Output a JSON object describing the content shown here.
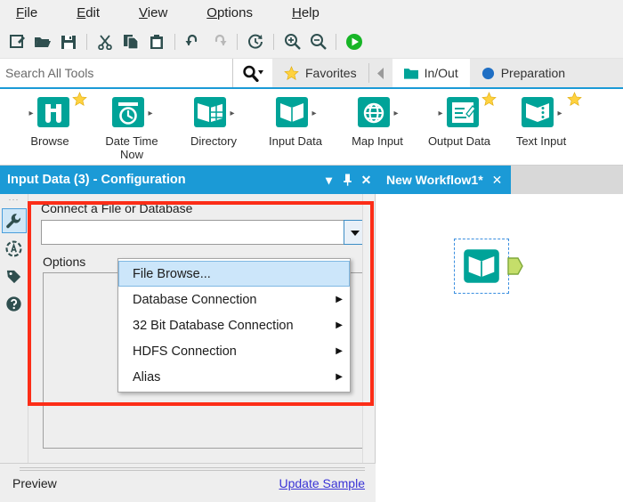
{
  "menu": {
    "items": [
      {
        "label": "File",
        "accel": "F"
      },
      {
        "label": "Edit",
        "accel": "E"
      },
      {
        "label": "View",
        "accel": "V"
      },
      {
        "label": "Options",
        "accel": "O"
      },
      {
        "label": "Help",
        "accel": "H"
      }
    ]
  },
  "toolbar": {
    "buttons": [
      {
        "name": "new-workflow-icon",
        "title": "New"
      },
      {
        "name": "open-folder-icon",
        "title": "Open"
      },
      {
        "name": "save-icon",
        "title": "Save"
      },
      {
        "name": "cut-scissors-icon",
        "title": "Cut"
      },
      {
        "name": "copy-icon",
        "title": "Copy"
      },
      {
        "name": "paste-clipboard-icon",
        "title": "Paste"
      },
      {
        "name": "undo-arrow-icon",
        "title": "Undo"
      },
      {
        "name": "redo-arrow-icon",
        "title": "Redo"
      },
      {
        "name": "refresh-clock-icon",
        "title": "Refresh"
      },
      {
        "name": "zoom-in-icon",
        "title": "Zoom In"
      },
      {
        "name": "zoom-out-icon",
        "title": "Zoom Out"
      },
      {
        "name": "run-play-icon",
        "title": "Run Workflow"
      }
    ]
  },
  "search": {
    "placeholder": "Search All Tools",
    "value": "",
    "button_icon": "search-magnifier-dropdown-icon"
  },
  "categories": {
    "scroll_left_icon": "chevron-left-icon",
    "tabs": [
      {
        "label": "Favorites",
        "icon": "star-icon",
        "active": false
      },
      {
        "label": "In/Out",
        "icon": "folder-icon",
        "active": true
      },
      {
        "label": "Preparation",
        "icon": "circle-icon",
        "active": false
      }
    ]
  },
  "ribbon": {
    "tools": [
      {
        "label": "Browse",
        "icon": "binoculars-icon",
        "favorite": true,
        "chevron": "left"
      },
      {
        "label": "Date Time\nNow",
        "icon": "clock-icon",
        "favorite": false,
        "chevron": "right"
      },
      {
        "label": "Directory",
        "icon": "book-grid-icon",
        "favorite": false,
        "chevron": "right"
      },
      {
        "label": "Input Data",
        "icon": "open-book-icon",
        "favorite": false,
        "chevron": "right"
      },
      {
        "label": "Map Input",
        "icon": "globe-icon",
        "favorite": false,
        "chevron": "right"
      },
      {
        "label": "Output Data",
        "icon": "write-page-icon",
        "favorite": true,
        "chevron": "left"
      },
      {
        "label": "Text Input",
        "icon": "book-dots-icon",
        "favorite": true,
        "chevron": "right"
      }
    ]
  },
  "config_panel": {
    "title": "Input Data (3) - Configuration",
    "window_controls": [
      {
        "name": "panel-menu-button",
        "glyph": "▾"
      },
      {
        "name": "panel-pin-button",
        "glyph": "📌"
      },
      {
        "name": "panel-close-button",
        "glyph": "✕"
      }
    ],
    "rail_items": [
      {
        "name": "sidebar-item-configuration",
        "icon": "wrench-icon",
        "active": true
      },
      {
        "name": "sidebar-item-annotation",
        "icon": "annotation-icon",
        "active": false
      },
      {
        "name": "sidebar-item-label",
        "icon": "tag-icon",
        "active": false
      },
      {
        "name": "sidebar-item-help",
        "icon": "question-help-icon",
        "active": false
      }
    ],
    "connect_label": "Connect a File or Database",
    "connect_value": "",
    "connect_dropdown_icon": "chevron-down-icon",
    "options_label": "Options",
    "preview_label": "Preview",
    "update_sample_link": "Update Sample"
  },
  "dropdown": {
    "items": [
      {
        "label": "File Browse...",
        "selected": true,
        "submenu": false
      },
      {
        "label": "Database Connection",
        "selected": false,
        "submenu": true
      },
      {
        "label": "32 Bit Database Connection",
        "selected": false,
        "submenu": true
      },
      {
        "label": "HDFS Connection",
        "selected": false,
        "submenu": true
      },
      {
        "label": "Alias",
        "selected": false,
        "submenu": true
      }
    ],
    "submenu_glyph": "▶"
  },
  "workflow": {
    "tabs": [
      {
        "label": "New Workflow1*",
        "close_glyph": "✕",
        "active": true
      }
    ],
    "node": {
      "name": "input-data-node",
      "icon": "open-book-icon",
      "selected": true
    }
  },
  "colors": {
    "accent_blue": "#1b9ad6",
    "teal": "#00a398",
    "highlight_red": "#fc2d17",
    "link_purple": "#3a34d6",
    "star_yellow": "#ffd23f",
    "run_green": "#17b526"
  }
}
